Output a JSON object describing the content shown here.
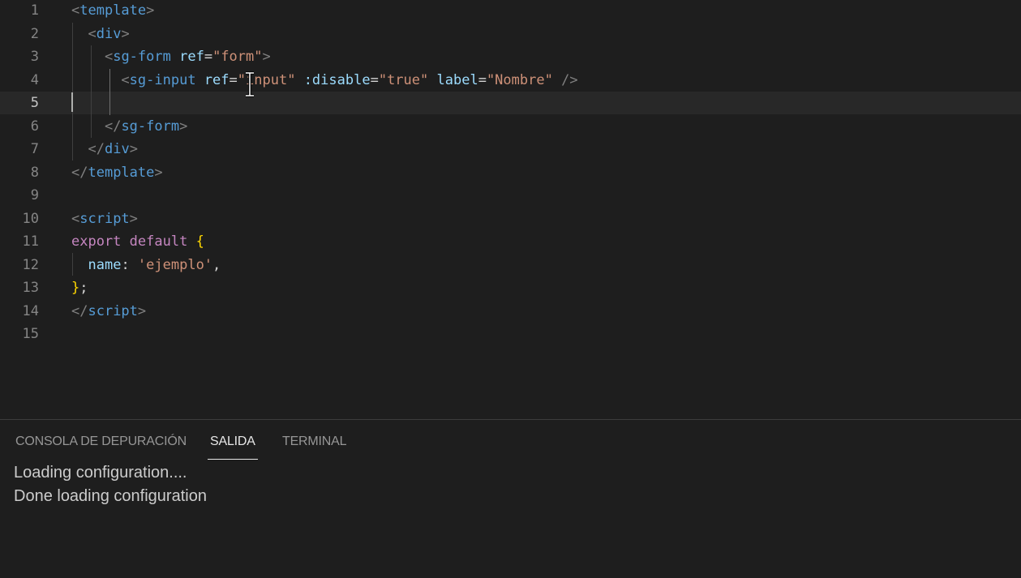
{
  "editor": {
    "current_line": 5,
    "lines": [
      {
        "n": "1",
        "tokens": [
          [
            "punc",
            "<"
          ],
          [
            "tag",
            "template"
          ],
          [
            "punc",
            ">"
          ]
        ]
      },
      {
        "n": "2",
        "tokens": [
          [
            "plain",
            "  "
          ],
          [
            "punc",
            "<"
          ],
          [
            "tag",
            "div"
          ],
          [
            "punc",
            ">"
          ]
        ]
      },
      {
        "n": "3",
        "tokens": [
          [
            "plain",
            "    "
          ],
          [
            "punc",
            "<"
          ],
          [
            "tag",
            "sg-form"
          ],
          [
            "plain",
            " "
          ],
          [
            "attr",
            "ref"
          ],
          [
            "eq",
            "="
          ],
          [
            "str",
            "\"form\""
          ],
          [
            "punc",
            ">"
          ]
        ]
      },
      {
        "n": "4",
        "tokens": [
          [
            "plain",
            "      "
          ],
          [
            "punc",
            "<"
          ],
          [
            "tag",
            "sg-input"
          ],
          [
            "plain",
            " "
          ],
          [
            "attr",
            "ref"
          ],
          [
            "eq",
            "="
          ],
          [
            "str",
            "\"input\""
          ],
          [
            "plain",
            " "
          ],
          [
            "attr",
            ":disable"
          ],
          [
            "eq",
            "="
          ],
          [
            "str",
            "\"true\""
          ],
          [
            "plain",
            " "
          ],
          [
            "attr",
            "label"
          ],
          [
            "eq",
            "="
          ],
          [
            "str",
            "\"Nombre\""
          ],
          [
            "plain",
            " "
          ],
          [
            "punc",
            "/>"
          ]
        ]
      },
      {
        "n": "5",
        "tokens": []
      },
      {
        "n": "6",
        "tokens": [
          [
            "plain",
            "    "
          ],
          [
            "punc",
            "</"
          ],
          [
            "tag",
            "sg-form"
          ],
          [
            "punc",
            ">"
          ]
        ]
      },
      {
        "n": "7",
        "tokens": [
          [
            "plain",
            "  "
          ],
          [
            "punc",
            "</"
          ],
          [
            "tag",
            "div"
          ],
          [
            "punc",
            ">"
          ]
        ]
      },
      {
        "n": "8",
        "tokens": [
          [
            "punc",
            "</"
          ],
          [
            "tag",
            "template"
          ],
          [
            "punc",
            ">"
          ]
        ]
      },
      {
        "n": "9",
        "tokens": []
      },
      {
        "n": "10",
        "tokens": [
          [
            "punc",
            "<"
          ],
          [
            "tag",
            "script"
          ],
          [
            "punc",
            ">"
          ]
        ]
      },
      {
        "n": "11",
        "tokens": [
          [
            "kw",
            "export"
          ],
          [
            "plain",
            " "
          ],
          [
            "kw",
            "default"
          ],
          [
            "plain",
            " "
          ],
          [
            "brace",
            "{"
          ]
        ]
      },
      {
        "n": "12",
        "tokens": [
          [
            "plain",
            "  "
          ],
          [
            "attr",
            "name"
          ],
          [
            "plain",
            ": "
          ],
          [
            "str",
            "'ejemplo'"
          ],
          [
            "plain",
            ","
          ]
        ]
      },
      {
        "n": "13",
        "tokens": [
          [
            "brace",
            "}"
          ],
          [
            "plain",
            ";"
          ]
        ]
      },
      {
        "n": "14",
        "tokens": [
          [
            "punc",
            "</"
          ],
          [
            "tag",
            "script"
          ],
          [
            "punc",
            ">"
          ]
        ]
      },
      {
        "n": "15",
        "tokens": []
      }
    ]
  },
  "panel": {
    "tabs": [
      {
        "label": "CONSOLA DE DEPURACIÓN",
        "active": false
      },
      {
        "label": "SALIDA",
        "active": true
      },
      {
        "label": "TERMINAL",
        "active": false
      }
    ],
    "output": [
      "Loading configuration....",
      "Done loading configuration"
    ]
  },
  "colors": {
    "background": "#1e1e1e",
    "tag": "#569cd6",
    "attribute": "#9cdcfe",
    "string": "#ce9178",
    "keyword": "#c586c0",
    "brace": "#ffd700"
  },
  "icons": {
    "mouse_cursor": "i-beam-cursor-icon"
  }
}
